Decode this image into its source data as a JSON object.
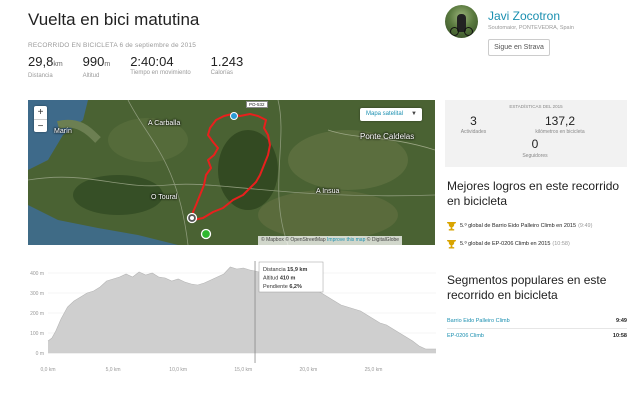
{
  "activity": {
    "title": "Vuelta en bici matutina",
    "type_label": "RECORRIDO EN BICICLETA",
    "date": "6 de septiembre de 2015"
  },
  "stats": [
    {
      "value": "29,8",
      "unit": "km",
      "label": "Distancia"
    },
    {
      "value": "990",
      "unit": "m",
      "label": "Altitud"
    },
    {
      "value": "2:40:04",
      "unit": "",
      "label": "Tiempo en movimiento"
    },
    {
      "value": "1.243",
      "unit": "",
      "label": "Calorías"
    }
  ],
  "athlete": {
    "name": "Javi Zocotron",
    "location": "Soutomaior, PONTEVEDRA, Spain",
    "follow_label": "Sigue en Strava"
  },
  "map": {
    "zoom_in": "+",
    "zoom_out": "−",
    "type_selector": "Mapa satelital",
    "places": [
      "Marín",
      "A Carballa",
      "Ponte Caldelas",
      "O Toural",
      "A Insua"
    ],
    "road_tag": "PO-532",
    "attribution_pre": "© Mapbox © OpenStreetMap ",
    "attribution_link": "Improve this map",
    "attribution_post": " © DigitalGlobe",
    "route_color": "#e8201d"
  },
  "profile": {
    "y_ticks": [
      "400 m",
      "300 m",
      "200 m",
      "100 m",
      "0 m"
    ],
    "x_ticks": [
      "0,0 km",
      "5,0 km",
      "10,0 km",
      "15,0 km",
      "20,0 km",
      "25,0 km"
    ],
    "tooltip": {
      "distance_label": "Distancia",
      "distance_value": "15,9 km",
      "altitude_label": "Altitud",
      "altitude_value": "410 m",
      "grade_label": "Pendiente",
      "grade_value": "6,2%"
    }
  },
  "chart_data": {
    "type": "area",
    "xlabel": "",
    "ylabel": "",
    "x": [
      0,
      0.3,
      0.6,
      1.0,
      1.5,
      2.0,
      2.5,
      3.0,
      3.5,
      4.0,
      4.5,
      5.0,
      5.5,
      6.0,
      6.5,
      7.0,
      7.5,
      8.0,
      8.5,
      9.0,
      9.5,
      10.0,
      10.5,
      11.0,
      11.5,
      12.0,
      12.5,
      13.0,
      13.5,
      14.0,
      14.5,
      15.0,
      15.5,
      15.9,
      16.5,
      17.0,
      17.5,
      18.0,
      18.5,
      19.0,
      19.5,
      20.0,
      20.5,
      21.0,
      21.5,
      22.0,
      22.5,
      23.0,
      23.5,
      24.0,
      24.5,
      25.0,
      25.5,
      26.0,
      26.5,
      27.0,
      27.5,
      28.0,
      28.5,
      29.0,
      29.8
    ],
    "values": [
      60,
      75,
      110,
      170,
      230,
      260,
      280,
      300,
      310,
      330,
      360,
      370,
      380,
      395,
      380,
      405,
      390,
      400,
      380,
      375,
      360,
      370,
      355,
      345,
      340,
      350,
      365,
      380,
      395,
      430,
      420,
      425,
      415,
      410,
      400,
      395,
      390,
      370,
      360,
      380,
      350,
      340,
      320,
      300,
      280,
      260,
      240,
      230,
      220,
      210,
      190,
      170,
      150,
      140,
      120,
      100,
      80,
      60,
      35,
      20,
      20
    ],
    "xlim": [
      0,
      29.8
    ],
    "ylim": [
      0,
      450
    ]
  },
  "year_stats": {
    "header": "ESTADÍSTICAS DEL 2015",
    "activities_value": "3",
    "activities_label": "Actividades",
    "km_value": "137,2",
    "km_label": "kilómetros en bicicleta",
    "followers_value": "0",
    "followers_label": "Seguidores"
  },
  "achievements": {
    "heading": "Mejores logros en este recorrido en bicicleta",
    "items": [
      {
        "text": "5.º global de Barrio Eido Palleiro Climb en 2015",
        "time": "(9:49)"
      },
      {
        "text": "5.º global de EP-0206 Climb en 2015",
        "time": "(10:58)"
      }
    ]
  },
  "segments": {
    "heading": "Segmentos populares en este recorrido en bicicleta",
    "items": [
      {
        "name": "Barrio Eido Palleiro Climb",
        "time": "9:49"
      },
      {
        "name": "EP-0206 Climb",
        "time": "10:58"
      }
    ]
  }
}
